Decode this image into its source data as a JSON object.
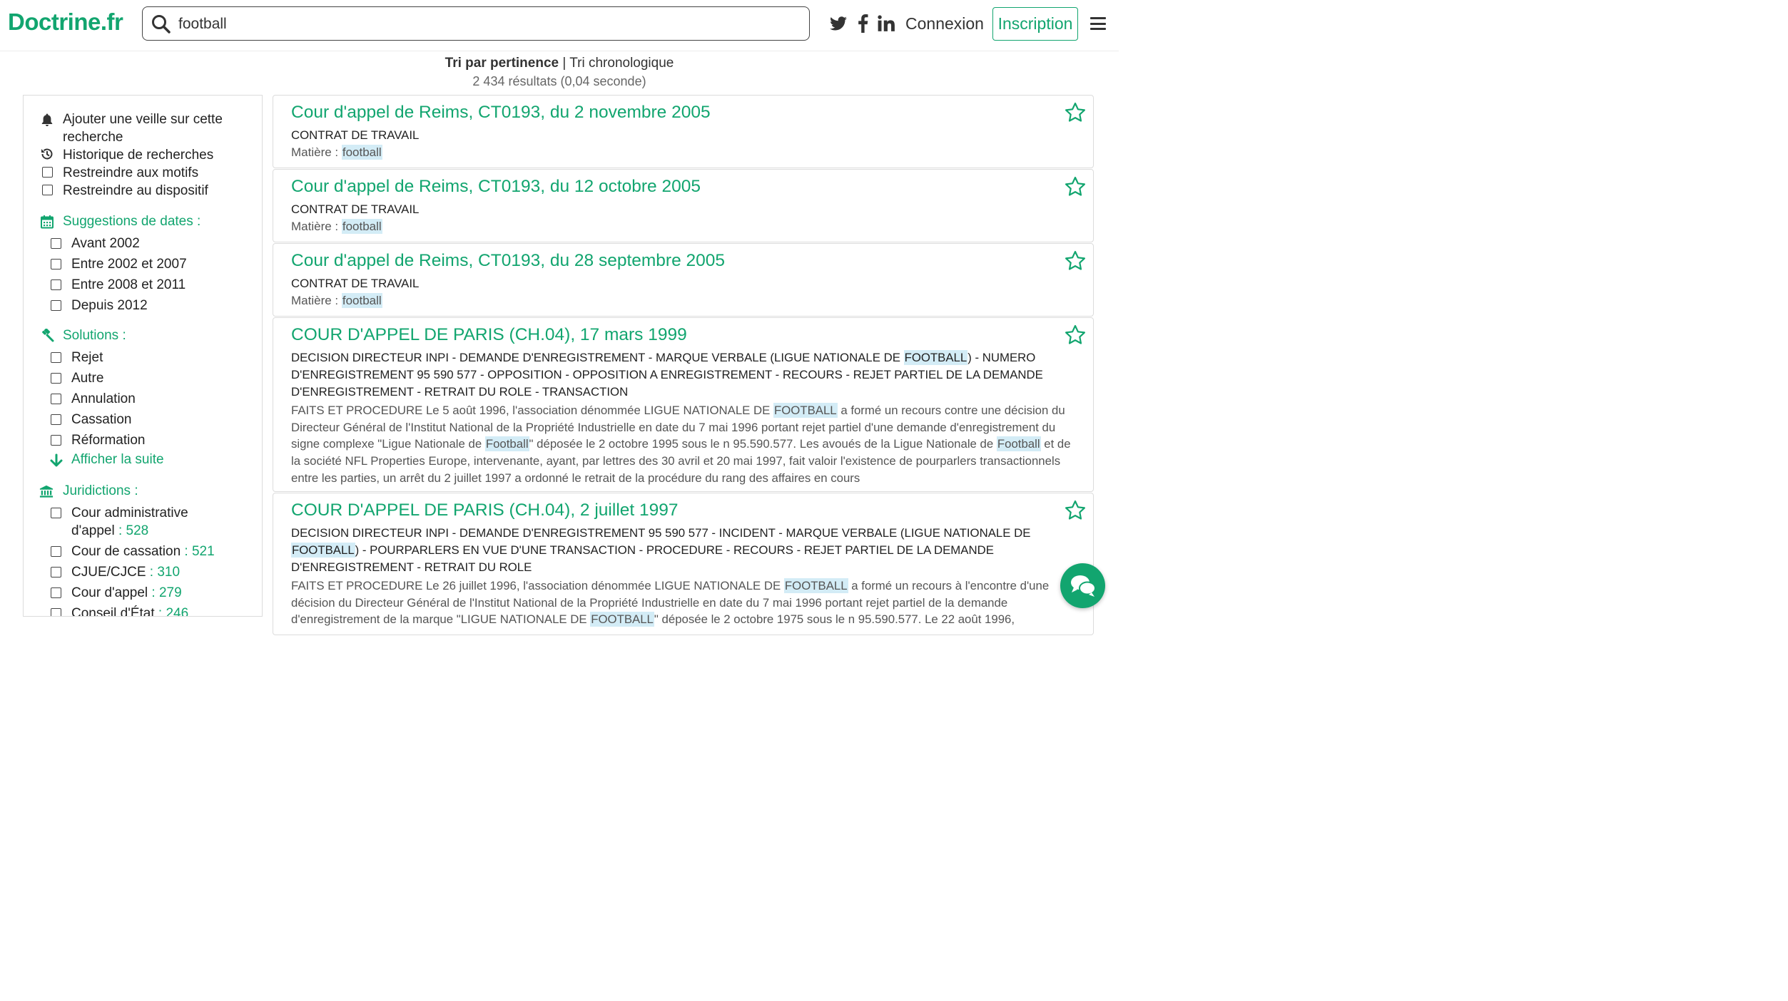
{
  "header": {
    "logo": "Doctrine.fr",
    "search_value": "football",
    "connexion": "Connexion",
    "inscription": "Inscription"
  },
  "sort": {
    "active": "Tri par pertinence",
    "separator": "|",
    "other": "Tri chronologique"
  },
  "results_count": "2 434 résultats (0,04 seconde)",
  "sidebar": {
    "actions": [
      {
        "label_line1": "Ajouter une veille sur cette",
        "label_line2": "recherche",
        "icon": "bell-icon"
      },
      {
        "label": "Historique de recherches",
        "icon": "history-icon"
      },
      {
        "label": "Restreindre aux motifs",
        "icon": "checkbox"
      },
      {
        "label": "Restreindre au dispositif",
        "icon": "checkbox"
      }
    ],
    "dates": {
      "title": "Suggestions de dates :",
      "items": [
        "Avant 2002",
        "Entre 2002 et 2007",
        "Entre 2008 et 2011",
        "Depuis 2012"
      ]
    },
    "solutions": {
      "title": "Solutions :",
      "items": [
        "Rejet",
        "Autre",
        "Annulation",
        "Cassation",
        "Réformation"
      ],
      "more": "Afficher la suite"
    },
    "juridictions": {
      "title": "Juridictions :",
      "items": [
        {
          "label_line1": "Cour administrative",
          "label_line2": "d'appel",
          "count": " : 528"
        },
        {
          "label": "Cour de cassation",
          "count": " : 521"
        },
        {
          "label": "CJUE/CJCE",
          "count": " : 310"
        },
        {
          "label": "Cour d'appel",
          "count": " : 279"
        },
        {
          "label": "Conseil d'État",
          "count": " : 246"
        }
      ]
    }
  },
  "results": [
    {
      "title": "Cour d'appel de Reims, CT0193, du 2 novembre 2005",
      "subtitle": "CONTRAT DE TRAVAIL",
      "matiere_label": "Matière : ",
      "matiere_value": "football"
    },
    {
      "title": "Cour d'appel de Reims, CT0193, du 12 octobre 2005",
      "subtitle": "CONTRAT DE TRAVAIL",
      "matiere_label": "Matière : ",
      "matiere_value": "football"
    },
    {
      "title": "Cour d'appel de Reims, CT0193, du 28 septembre 2005",
      "subtitle": "CONTRAT DE TRAVAIL",
      "matiere_label": "Matière : ",
      "matiere_value": "football"
    },
    {
      "title": "COUR D'APPEL DE PARIS (CH.04), 17 mars 1999",
      "subtitle_parts": [
        "DECISION DIRECTEUR INPI - DEMANDE D'ENREGISTREMENT - MARQUE VERBALE (LIGUE NATIONALE DE ",
        "FOOTBALL",
        ") - NUMERO D'ENREGISTREMENT 95 590 577 - OPPOSITION - OPPOSITION A ENREGISTREMENT - RECOURS - REJET PARTIEL DE LA DEMANDE D'ENREGISTREMENT - RETRAIT DU ROLE - TRANSACTION"
      ],
      "excerpt_parts": [
        "FAITS ET PROCEDURE Le 5 août 1996, l'association dénommée LIGUE NATIONALE DE ",
        "FOOTBALL",
        " a formé un recours contre une décision du Directeur Général de l'Institut National de la Propriété Industrielle en date du 7 mai 1996 portant rejet partiel d'une demande d'enregistrement du signe complexe \"Ligue Nationale de ",
        "Football",
        "\" déposée le 2 octobre 1995 sous le n 95.590.577. Les avoués de la Ligue Nationale de ",
        "Football",
        " et de la société NFL Properties Europe, intervenante, ayant, par lettres des 30 avril et 20 mai 1997, fait valoir l'existence de pourparlers transactionnels entre les parties, un arrêt du 2 juillet 1997 a ordonné le retrait de la procédure du rang des affaires en cours"
      ]
    },
    {
      "title": "COUR D'APPEL DE PARIS (CH.04), 2 juillet 1997",
      "subtitle_parts": [
        "DECISION DIRECTEUR INPI - DEMANDE D'ENREGISTREMENT 95 590 577 - INCIDENT - MARQUE VERBALE (LIGUE NATIONALE DE ",
        "FOOTBALL",
        ") - POURPARLERS EN VUE D'UNE TRANSACTION - PROCEDURE - RECOURS - REJET PARTIEL DE LA DEMANDE D'ENREGISTREMENT - RETRAIT DU ROLE"
      ],
      "excerpt_parts": [
        "FAITS ET PROCEDURE Le 26 juillet 1996, l'association dénommée LIGUE NATIONALE DE ",
        "FOOTBALL",
        " a formé un recours à l'encontre d'une décision du Directeur Général de l'Institut National de la Propriété Industrielle en date du 7 mai 1996 portant rejet partiel de la demande d'enregistrement de la marque \"LIGUE NATIONALE DE ",
        "FOOTBALL",
        "\" déposée le 2 octobre 1975 sous le n 95.590.577. Le 22 août 1996,"
      ]
    }
  ],
  "colors": {
    "accent": "#12a56f",
    "highlight": "#d3ecf6"
  }
}
